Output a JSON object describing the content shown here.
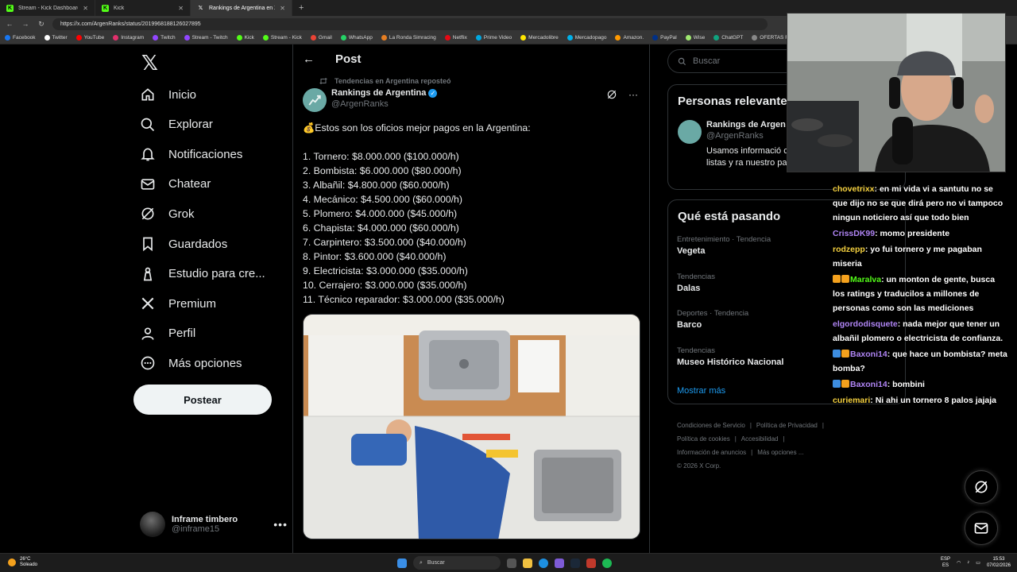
{
  "browser": {
    "tabs": [
      {
        "label": "Stream - Kick Dashboard",
        "favicon": "kick"
      },
      {
        "label": "Kick",
        "favicon": "kick"
      },
      {
        "label": "Rankings de Argentina en X: \"💰 E",
        "favicon": "x",
        "active": true
      }
    ],
    "url": "https://x.com/ArgenRanks/status/2019968188126027895",
    "bookmarks": [
      "Facebook",
      "Twitter",
      "YouTube",
      "Instagram",
      "Twitch",
      "Stream - Twitch",
      "Kick",
      "Stream - Kick",
      "Gmail",
      "WhatsApp",
      "La Ronda Simracing",
      "Netflix",
      "Prime Video",
      "Mercadolibre",
      "Mercadopago",
      "Amazon.",
      "PayPal",
      "Wise",
      "ChatGPT",
      "OFERTAS RIKY S"
    ]
  },
  "nav": {
    "items": [
      {
        "label": "Inicio",
        "icon": "home-icon"
      },
      {
        "label": "Explorar",
        "icon": "search-icon"
      },
      {
        "label": "Notificaciones",
        "icon": "bell-icon"
      },
      {
        "label": "Chatear",
        "icon": "mail-icon"
      },
      {
        "label": "Grok",
        "icon": "grok-icon"
      },
      {
        "label": "Guardados",
        "icon": "bookmark-icon"
      },
      {
        "label": "Estudio para cre...",
        "icon": "creator-studio-icon"
      },
      {
        "label": "Premium",
        "icon": "x-logo-icon"
      },
      {
        "label": "Perfil",
        "icon": "person-icon"
      },
      {
        "label": "Más opciones",
        "icon": "more-circle-icon"
      }
    ],
    "post_button": "Postear",
    "account": {
      "name": "Inframe timbero",
      "handle": "@inframe15"
    }
  },
  "post": {
    "header_title": "Post",
    "repost_note": "Tendencias en Argentina reposteó",
    "author_name": "Rankings de Argentina",
    "author_handle": "@ArgenRanks",
    "intro": "💰Estos son los oficios mejor pagos en la Argentina:",
    "lines": [
      "1. Tornero: $8.000.000 ($100.000/h)",
      "2.  Bombista: $6.000.000 ($80.000/h)",
      "3.  Albañil: $4.800.000 ($60.000/h)",
      "4.  Mecánico: $4.500.000 ($60.000/h)",
      "5.  Plomero: $4.000.000 ($45.000/h)",
      "6.  Chapista: $4.000.000 ($60.000/h)",
      "7.  Carpintero: $3.500.000 ($40.000/h)",
      "8.  Pintor: $3.600.000 ($40.000/h)",
      "9.  Electricista: $3.000.000 ($35.000/h)",
      "10.  Cerrajero: $3.000.000 ($35.000/h)",
      "11.  Técnico reparador: $3.000.000 ($35.000/h)"
    ]
  },
  "sidebar": {
    "search_placeholder": "Buscar",
    "relevant_title": "Personas relevantes",
    "relevant_user": {
      "name": "Rankings de Argen",
      "handle": "@ArgenRanks",
      "bio": "Usamos informació compartir listas y ra nuestro país."
    },
    "trends_title": "Qué está pasando",
    "trends": [
      {
        "category": "Entretenimiento · Tendencia",
        "name": "Vegeta"
      },
      {
        "category": "Tendencias",
        "name": "Dalas"
      },
      {
        "category": "Deportes · Tendencia",
        "name": "Barco"
      },
      {
        "category": "Tendencias",
        "name": "Museo Histórico Nacional"
      }
    ],
    "show_more": "Mostrar más",
    "footer": {
      "line1": [
        "Condiciones de Servicio",
        "Política de Privacidad"
      ],
      "line2": [
        "Política de cookies",
        "Accesibilidad"
      ],
      "line3": [
        "Información de anuncios",
        "Más opciones ..."
      ],
      "copyright": "© 2026 X Corp."
    }
  },
  "chat": [
    {
      "user": "chovetrixx",
      "color": "#f4d03f",
      "text": ": en mi vida vi a santutu no se que dijo no se que dirá pero no vi tampoco ningun noticiero así que todo bien",
      "badges": []
    },
    {
      "user": "CrissDK99",
      "color": "#b085f5",
      "text": ": momo presidente",
      "badges": []
    },
    {
      "user": "rodzepp",
      "color": "#f4d03f",
      "text": ": yo fui tornero y me pagaban miseria",
      "badges": []
    },
    {
      "user": "Maralva",
      "color": "#53fc18",
      "text": ": un monton de gente, busca los ratings y traducilos a millones de personas como son las mediciones",
      "badges": [
        "#f4a11d",
        "#f4a11d"
      ]
    },
    {
      "user": "elgordodisquete",
      "color": "#b085f5",
      "text": ": nada mejor que tener un albañil plomero o electricista de confianza.",
      "badges": []
    },
    {
      "user": "Baxoni14",
      "color": "#b085f5",
      "text": ": que hace un bombista? meta bomba?",
      "badges": [
        "#3d8de0",
        "#f4a11d"
      ]
    },
    {
      "user": "Baxoni14",
      "color": "#b085f5",
      "text": ": bombini",
      "badges": [
        "#3d8de0",
        "#f4a11d"
      ]
    },
    {
      "user": "curiemari",
      "color": "#f4d03f",
      "text": ": Ni ahi un tornero 8 palos jajaja",
      "badges": []
    }
  ],
  "taskbar": {
    "weather_temp": "26°C",
    "weather_desc": "Soleado",
    "search": "Buscar",
    "lang_top": "ESP",
    "lang_bottom": "ES",
    "time": "15:53",
    "date": "07/02/2026"
  }
}
